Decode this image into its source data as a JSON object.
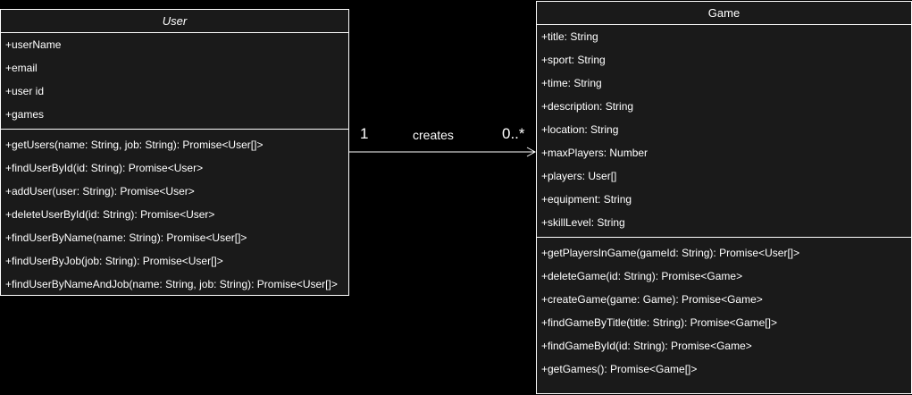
{
  "user_class": {
    "name": "User",
    "attributes": [
      "+userName",
      "+email",
      "+user id",
      "+games"
    ],
    "methods": [
      "+getUsers(name: String, job: String): Promise<User[]>",
      "+findUserById(id: String): Promise<User>",
      "+addUser(user: String): Promise<User>",
      "+deleteUserById(id: String): Promise<User>",
      "+findUserByName(name: String): Promise<User[]>",
      "+findUserByJob(job: String): Promise<User[]>",
      "+findUserByNameAndJob(name: String, job: String): Promise<User[]>"
    ]
  },
  "game_class": {
    "name": "Game",
    "attributes": [
      "+title: String",
      "+sport: String",
      "+time: String",
      "+description: String",
      "+location: String",
      "+maxPlayers: Number",
      "+players: User[]",
      "+equipment: String",
      "+skillLevel: String"
    ],
    "methods": [
      "+getPlayersInGame(gameId: String): Promise<User[]>",
      "+deleteGame(id: String): Promise<Game>",
      "+createGame(game: Game): Promise<Game>",
      "+findGameByTitle(title: String): Promise<Game[]>",
      "+findGameById(id: String): Promise<Game>",
      "+getGames(): Promise<Game[]>"
    ]
  },
  "association": {
    "label": "creates",
    "source_multiplicity": "1",
    "target_multiplicity": "0..*"
  },
  "colors": {
    "background": "#000000",
    "box_fill": "#1a1a1a",
    "stroke": "#ffffff",
    "text": "#ffffff"
  }
}
